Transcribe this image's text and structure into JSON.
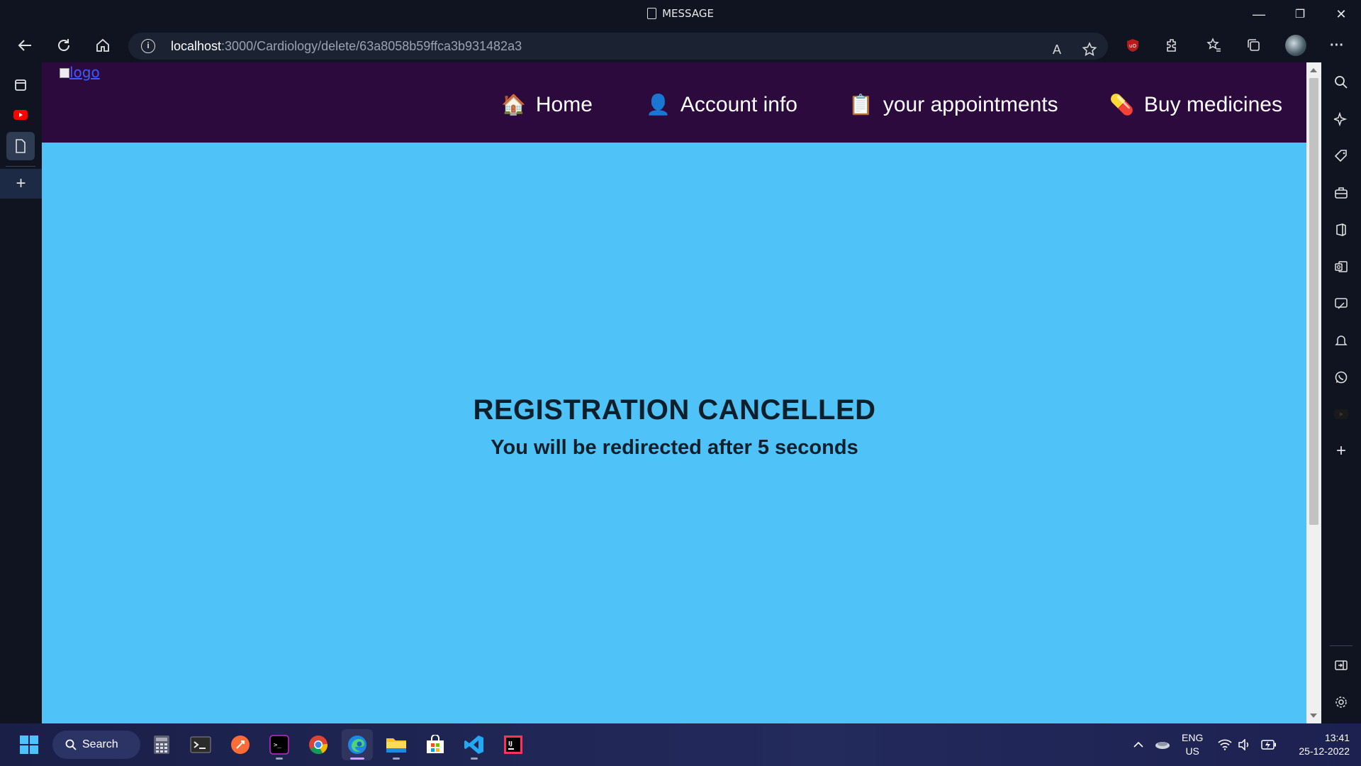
{
  "window": {
    "title": "MESSAGE",
    "minimize_glyph": "—",
    "restore_glyph": "❐",
    "close_glyph": "✕"
  },
  "address_bar": {
    "url_host": "localhost",
    "url_path": ":3000/Cardiology/delete/63a8058b59ffca3b931482a3",
    "read_aloud_glyph": "A",
    "more_glyph": "···"
  },
  "site_nav": {
    "logo_alt": "logo",
    "links": [
      {
        "icon": "🏠",
        "label": "Home"
      },
      {
        "icon": "👤",
        "label": "Account info"
      },
      {
        "icon": "📋",
        "label": "your appointments"
      },
      {
        "icon": "💊",
        "label": "Buy medicines"
      }
    ]
  },
  "content": {
    "heading": "REGISTRATION CANCELLED",
    "subheading": "You will be redirected after 5 seconds"
  },
  "taskbar": {
    "search_label": "Search",
    "language_line1": "ENG",
    "language_line2": "US",
    "time": "13:41",
    "date": "25-12-2022",
    "plus_glyph": "+"
  },
  "colors": {
    "page_background": "#4fc3f7",
    "site_nav_background": "#2d0a3e",
    "browser_chrome": "#0f1420"
  }
}
